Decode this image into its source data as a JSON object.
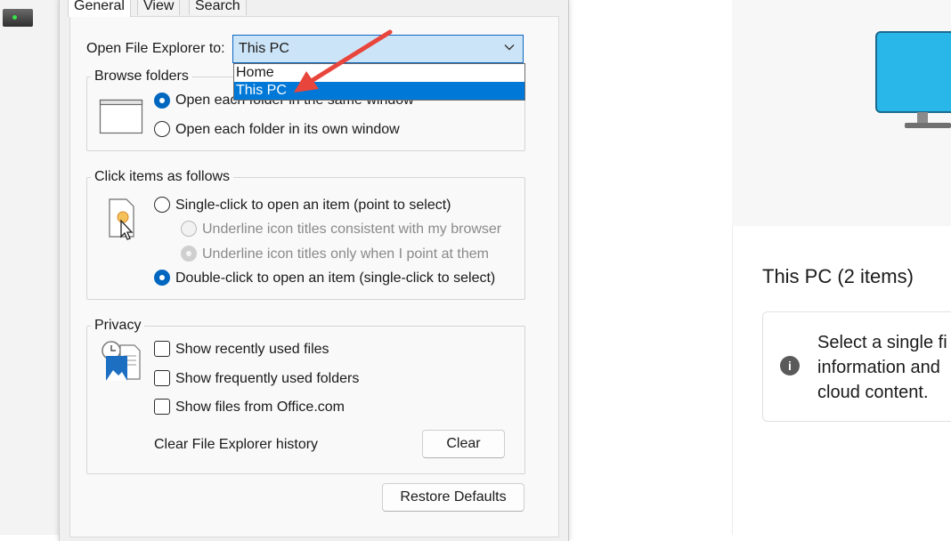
{
  "tabs": {
    "general": "General",
    "view": "View",
    "search": "Search"
  },
  "open_explorer": {
    "label": "Open File Explorer to:",
    "selected": "This PC",
    "options": [
      "Home",
      "This PC"
    ]
  },
  "browse_folders": {
    "title": "Browse folders",
    "option_same_window": "Open each folder in the same window",
    "option_own_window": "Open each folder in its own window"
  },
  "click_items": {
    "title": "Click items as follows",
    "single_click": "Single-click to open an item (point to select)",
    "underline_browser": "Underline icon titles consistent with my browser",
    "underline_point": "Underline icon titles only when I point at them",
    "double_click": "Double-click to open an item (single-click to select)"
  },
  "privacy": {
    "title": "Privacy",
    "recent_files": "Show recently used files",
    "frequent_folders": "Show frequently used folders",
    "office_files": "Show files from Office.com",
    "clear_history_label": "Clear File Explorer history",
    "clear_button": "Clear"
  },
  "restore_defaults": "Restore Defaults",
  "right_panel": {
    "heading": "This PC (2 items)",
    "info_line1": "Select a single fi",
    "info_line2": "information and",
    "info_line3": "cloud content.",
    "info_icon": "i"
  },
  "colors": {
    "accent": "#0067c0",
    "selection": "#0078d7",
    "combo_bg": "#cce4f7",
    "annotation_arrow": "#e8453c",
    "monitor": "#29b6e8"
  }
}
